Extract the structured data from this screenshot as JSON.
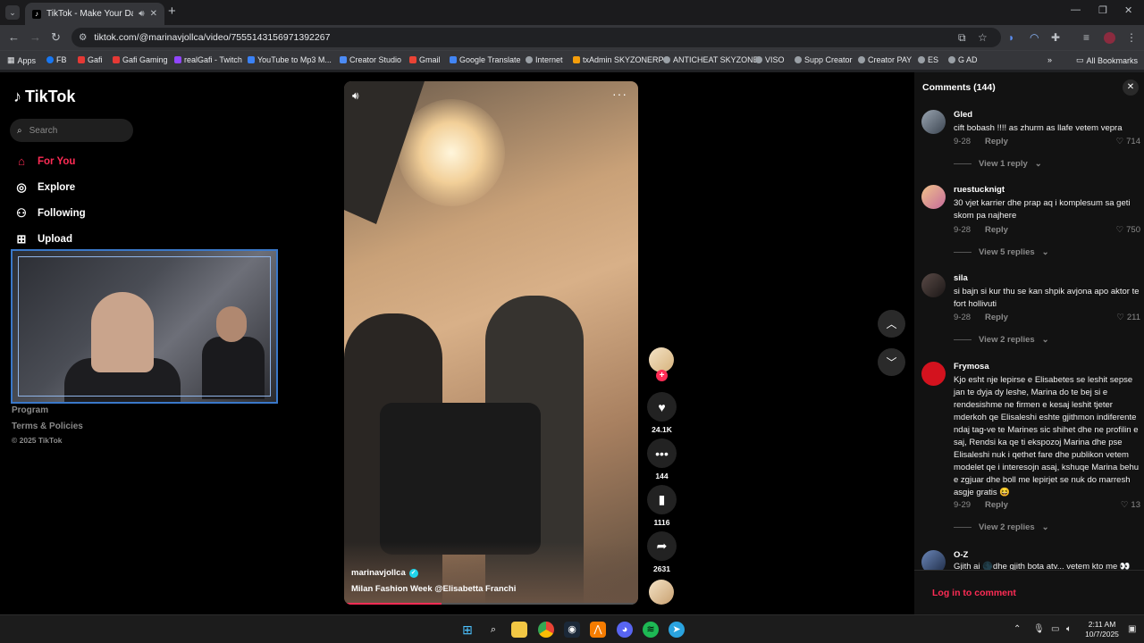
{
  "browser": {
    "tab_title": "TikTok - Make Your Day",
    "url": "tiktok.com/@marinavjollca/video/7555143156971392267",
    "bookmarks": [
      "Apps",
      "FB",
      "Gafi",
      "Gafi Gaming",
      "realGafi - Twitch",
      "YouTube to Mp3 M...",
      "Creator Studio",
      "Gmail",
      "Google Translate",
      "Internet",
      "txAdmin SKYZONERP",
      "ANTICHEAT SKYZONE",
      "VISO",
      "Supp Creator",
      "Creator PAY",
      "ES",
      "G AD"
    ],
    "all_bookmarks": "All Bookmarks",
    "bookmark_colors": [
      "#8ab4f8",
      "#1877f2",
      "#e53935",
      "#e53935",
      "#9146ff",
      "#3b82f6",
      "#4c8bf5",
      "#ea4335",
      "#4285f4",
      "#9aa0a6",
      "#f59e0b",
      "#9aa0a6",
      "#9aa0a6",
      "#9aa0a6",
      "#9aa0a6",
      "#9aa0a6",
      "#9aa0a6"
    ]
  },
  "sidebar": {
    "logo": "TikTok",
    "search_placeholder": "Search",
    "nav": [
      {
        "label": "For You",
        "icon": "home-icon"
      },
      {
        "label": "Explore",
        "icon": "compass-icon"
      },
      {
        "label": "Following",
        "icon": "following-icon"
      },
      {
        "label": "Upload",
        "icon": "upload-icon"
      }
    ],
    "footer_links": [
      "Program",
      "Terms & Policies"
    ],
    "copyright": "© 2025 TikTok"
  },
  "video": {
    "author": "marinavjollca",
    "caption": "Milan Fashion Week @Elisabetta Franchi",
    "progress": 0.33,
    "likes": "24.1K",
    "comments": "144",
    "saves": "1116",
    "shares": "2631"
  },
  "comments": {
    "header": "Comments (144)",
    "items": [
      {
        "user": "Gled",
        "text": "cift bobash !!!! as zhurm as llafe vetem vepra",
        "date": "9-28",
        "reply": "Reply",
        "likes": "714",
        "view": "View 1 reply"
      },
      {
        "user": "ruestucknigt",
        "text": "30 vjet karrier dhe prap aq i komplesum sa geti skom pa najhere",
        "date": "9-28",
        "reply": "Reply",
        "likes": "750",
        "view": "View 5 replies"
      },
      {
        "user": "sila",
        "text": "si bajn si kur thu se kan shpik avjona apo aktor te fort hollivuti",
        "date": "9-28",
        "reply": "Reply",
        "likes": "211",
        "view": "View 2 replies"
      },
      {
        "user": "Frymosa",
        "text": "Kjo esht nje lepirse e Elisabetes se leshit sepse jan te dyja dy leshe, Marina do te bej si e rendesishme ne firmen e kesaj leshit tjeter mderkoh qe Elisaleshi eshte gjithmon indiferente ndaj tag-ve te Marines sic shihet dhe ne profilin e saj, Rendsi ka qe ti ekspozoj Marina dhe pse Elisaleshi nuk i qethet fare dhe publikon vetem modelet qe i interesojn asaj, kshuqe Marina behu e zgjuar dhe boll me lepirjet se nuk do marresh asgje gratis 😆",
        "date": "9-29",
        "reply": "Reply",
        "likes": "13",
        "view": "View 2 replies"
      },
      {
        "user": "O-Z",
        "text": "Gjith ai 🌑dhe gjith bota atv... vetem kto me 👀",
        "date": "",
        "reply": "",
        "likes": "",
        "view": ""
      }
    ],
    "login": "Log in to comment"
  },
  "taskbar": {
    "time": "2:11 AM",
    "date": "10/7/2025"
  },
  "colors": {
    "accent": "#fe2c55",
    "verified": "#20d5ec",
    "browser_bg": "#202124",
    "panel_bg": "#121212"
  }
}
